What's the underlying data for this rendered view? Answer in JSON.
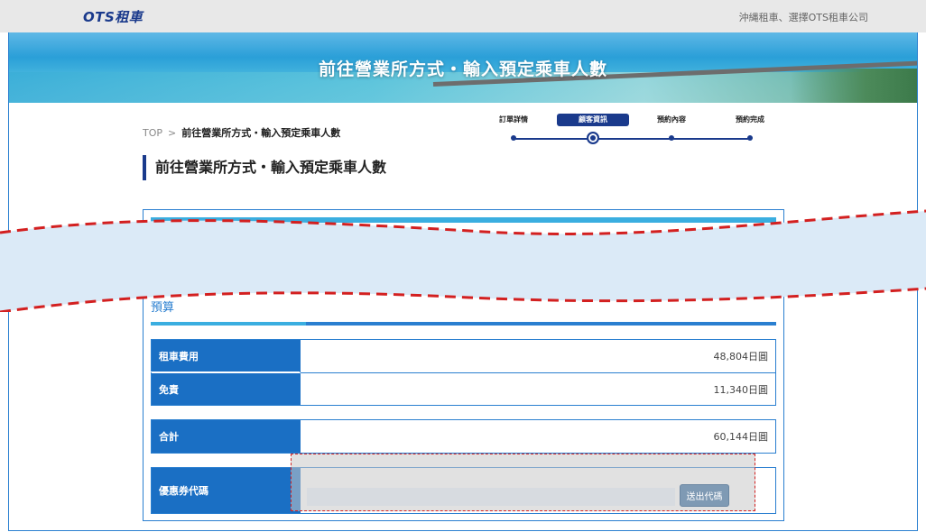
{
  "header": {
    "logo": "OTS租車",
    "tagline": "沖縄租車、選擇OTS租車公司"
  },
  "banner": {
    "title": "前往營業所方式・輸入預定乘車人數"
  },
  "breadcrumb": {
    "home": "TOP",
    "separator": ">",
    "current": "前往營業所方式・輸入預定乘車人數"
  },
  "steps": [
    {
      "label": "訂單詳情",
      "active": false
    },
    {
      "label": "顧客資訊",
      "active": true
    },
    {
      "label": "預約內容",
      "active": false
    },
    {
      "label": "預約完成",
      "active": false
    }
  ],
  "section": {
    "heading": "前往營業所方式・輸入預定乘車人數"
  },
  "budget": {
    "title": "預算",
    "rows": [
      {
        "label": "租車費用",
        "value": "48,804日圓"
      },
      {
        "label": "免責",
        "value": "11,340日圓"
      }
    ],
    "total": {
      "label": "合計",
      "value": "60,144日圓"
    },
    "coupon": {
      "label": "優惠券代碼",
      "input_value": "",
      "placeholder": "",
      "button_label": "送出代碼"
    }
  },
  "colors": {
    "brand_navy": "#1a3a8c",
    "accent_blue": "#1a6fc4",
    "light_blue": "#3aaee0",
    "cut_line": "#d32020",
    "cut_fill": "#dbeaf7"
  }
}
